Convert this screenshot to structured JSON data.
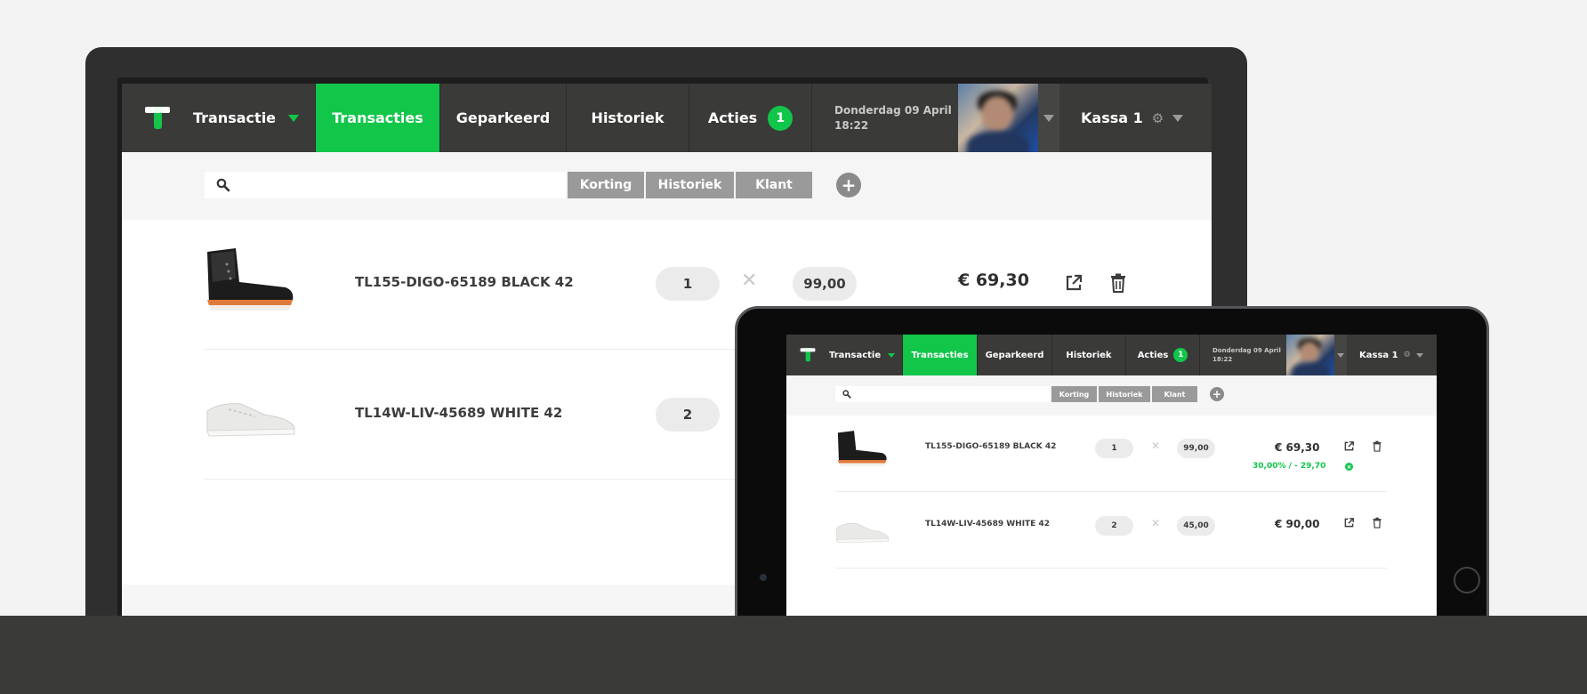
{
  "nav": {
    "dropdown_label": "Transactie",
    "tabs": [
      {
        "label": "Transacties",
        "active": true
      },
      {
        "label": "Geparkeerd",
        "active": false
      },
      {
        "label": "Historiek",
        "active": false
      },
      {
        "label": "Acties",
        "active": false,
        "badge": "1"
      }
    ],
    "date_line1": "Donderdag 09 April",
    "date_line2": "18:22",
    "register": "Kassa 1",
    "accent_color": "#12c64a",
    "navbar_color": "#3a3a39"
  },
  "search": {
    "placeholder": "",
    "buttons": [
      "Korting",
      "Historiek",
      "Klant"
    ],
    "add_icon": "plus-icon"
  },
  "desktop_items": [
    {
      "name": "TL155-DIGO-65189 BLACK 42",
      "qty": "1",
      "unit_price": "99,00",
      "total": "€ 69,30",
      "image": "black-boot"
    },
    {
      "name": "TL14W-LIV-45689 WHITE 42",
      "qty": "2",
      "image": "white-sneaker"
    }
  ],
  "tablet_items": [
    {
      "name": "TL155-DIGO-65189 BLACK 42",
      "qty": "1",
      "unit_price": "99,00",
      "total": "€ 69,30",
      "discount": "30,00% / - 29,70",
      "image": "black-boot"
    },
    {
      "name": "TL14W-LIV-45689 WHITE 42",
      "qty": "2",
      "unit_price": "45,00",
      "total": "€ 90,00",
      "image": "white-sneaker"
    }
  ],
  "icons": [
    "search-icon",
    "plus-icon",
    "external-link-icon",
    "trash-icon",
    "gear-icon",
    "chevron-down-icon",
    "close-x-icon"
  ]
}
